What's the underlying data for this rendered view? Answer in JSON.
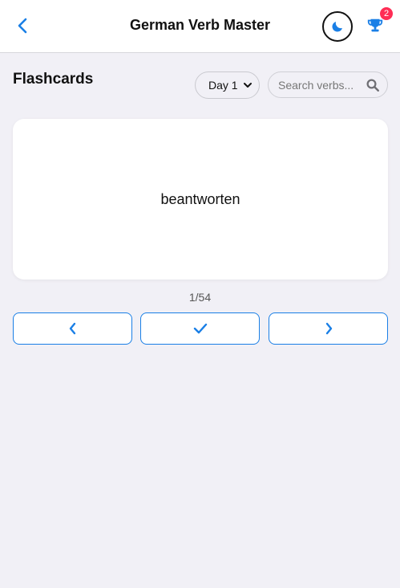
{
  "header": {
    "title": "German Verb Master",
    "notification_count": "2",
    "icons": {
      "back": "chevron-left-icon",
      "theme": "moon-icon",
      "achievements": "trophy-icon"
    }
  },
  "section": {
    "title": "Flashcards"
  },
  "filters": {
    "day_selected": "Day 1",
    "search_placeholder": "Search verbs..."
  },
  "card": {
    "word": "beantworten"
  },
  "progress": {
    "text": "1/54"
  },
  "controls": {
    "icons": [
      "chevron-left-icon",
      "check-icon",
      "chevron-right-icon"
    ]
  },
  "colors": {
    "accent": "#1a7fe6",
    "badge": "#ff2d55",
    "background": "#f1f0f6"
  }
}
